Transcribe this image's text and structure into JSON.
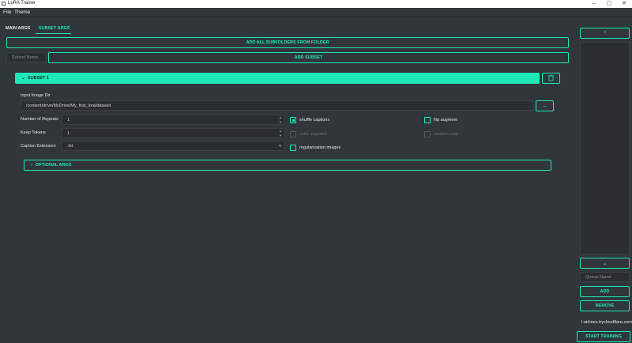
{
  "window": {
    "title": "LoRA Trainer",
    "minimize": "–",
    "maximize": "▢",
    "close": "✕"
  },
  "menu": {
    "file": "File",
    "theme": "Theme"
  },
  "tabs": {
    "main": "MAIN ARGS",
    "subset": "SUBSET ARGS"
  },
  "buttons": {
    "add_all": "ADD ALL SUBFOLDERS FROM FOLDER",
    "add_subset": "ADD SUBSET",
    "browse": "...",
    "queue_add": "ADD",
    "queue_remove": "REMOVE",
    "start": "START TRAINING"
  },
  "subset_name": {
    "placeholder": "Subset Name"
  },
  "subset": {
    "header": "SUBSET 1",
    "image_dir_label": "Input Image Dir",
    "image_dir_value": "/content/drive/MyDrive/My_first_lora/dataset",
    "repeats_label": "Number of Repeats",
    "repeats_value": "1",
    "keep_tokens_label": "Keep Tokens",
    "keep_tokens_value": "1",
    "caption_ext_label": "Caption Extension",
    "caption_ext_value": ".txt",
    "optional": "OPTIONAL ARGS",
    "checks": {
      "shuffle": "shuffle captions",
      "flip": "flip augment",
      "color": "color augment",
      "random_crop": "random crop",
      "reg_images": "regularization images"
    }
  },
  "queue": {
    "name_placeholder": "Queue Name",
    "host": "l-airlines.trycloudflare.com"
  },
  "colors": {
    "accent": "#1de9b6",
    "background": "#31363b",
    "input": "#2a2d31"
  }
}
